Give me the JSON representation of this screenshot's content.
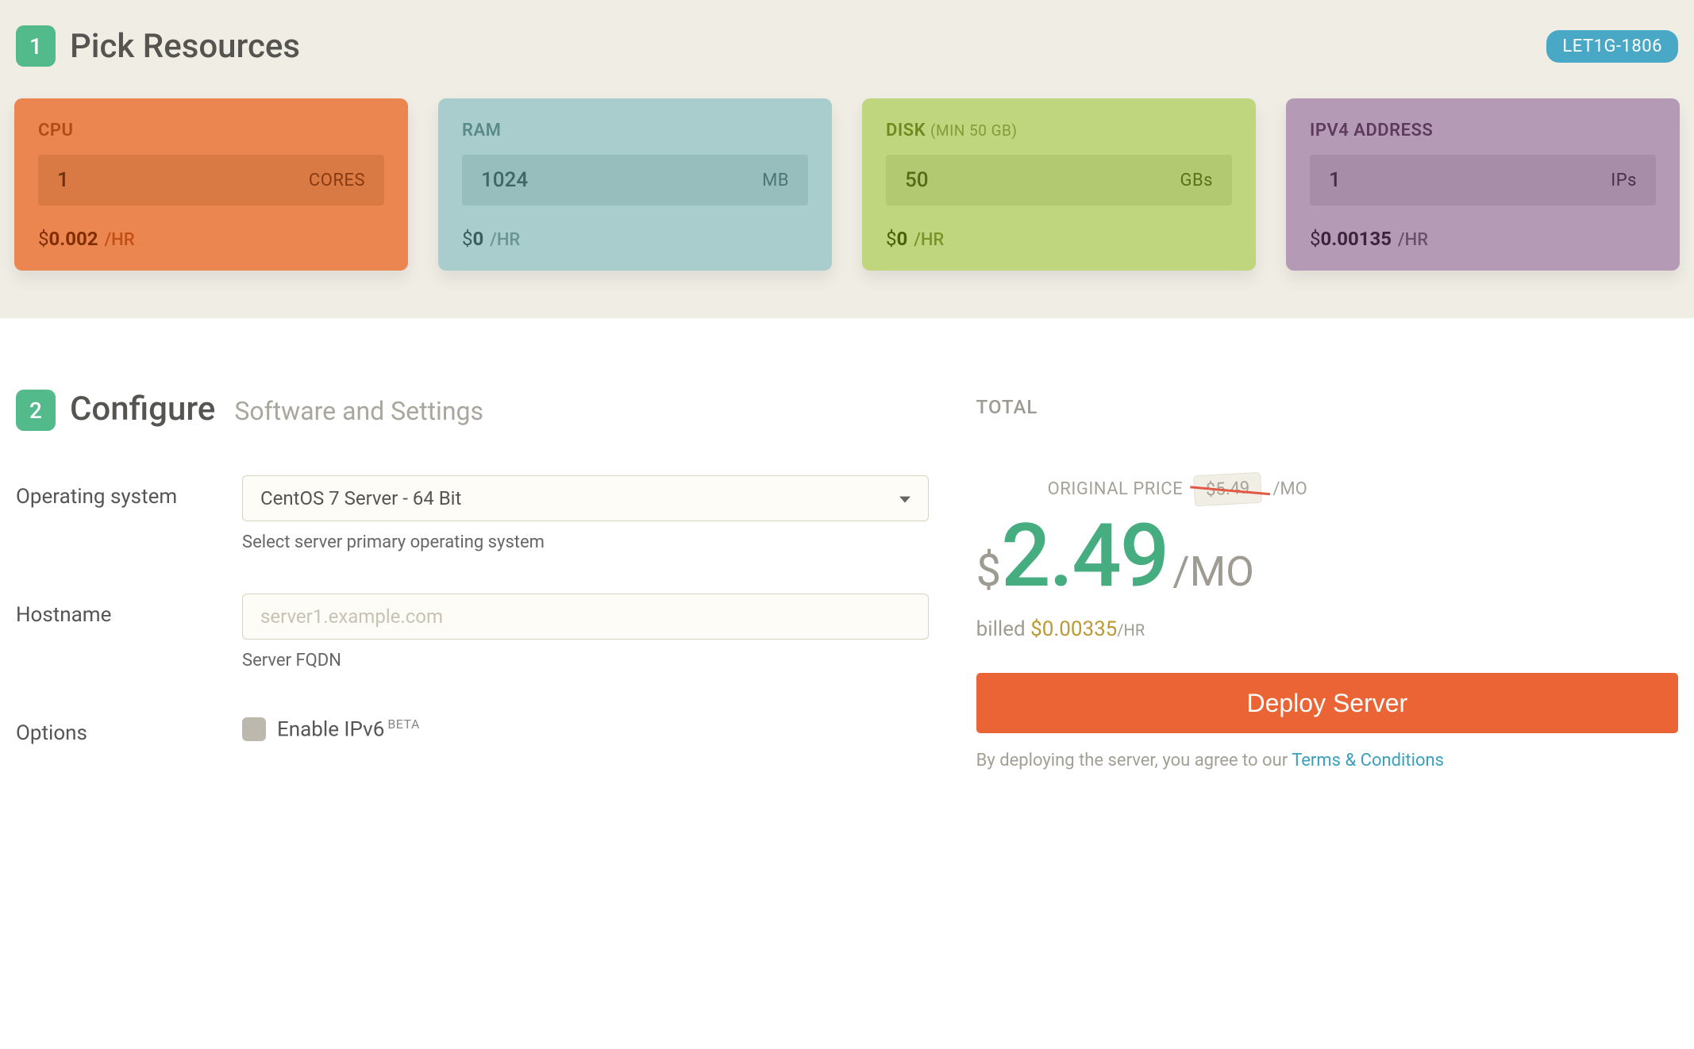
{
  "section1": {
    "step": "1",
    "title": "Pick Resources",
    "promo_code": "LET1G-1806",
    "cards": {
      "cpu": {
        "label": "CPU",
        "label_sub": "",
        "value": "1",
        "unit": "CORES",
        "currency": "$",
        "price": "0.002",
        "per": "/HR"
      },
      "ram": {
        "label": "RAM",
        "label_sub": "",
        "value": "1024",
        "unit": "MB",
        "currency": "$",
        "price": "0",
        "per": "/HR"
      },
      "disk": {
        "label": "DISK",
        "label_sub": "(MIN 50 GB)",
        "value": "50",
        "unit": "GBs",
        "currency": "$",
        "price": "0",
        "per": "/HR"
      },
      "ip": {
        "label": "IPV4 ADDRESS",
        "label_sub": "",
        "value": "1",
        "unit": "IPs",
        "currency": "$",
        "price": "0.00135",
        "per": "/HR"
      }
    }
  },
  "section2": {
    "step": "2",
    "title": "Configure",
    "subtitle": "Software and Settings",
    "os": {
      "label": "Operating system",
      "selected": "CentOS 7 Server - 64 Bit",
      "help": "Select server primary operating system"
    },
    "hostname": {
      "label": "Hostname",
      "placeholder": "server1.example.com",
      "help": "Server FQDN"
    },
    "options": {
      "label": "Options",
      "ipv6_label": "Enable IPv6",
      "ipv6_badge": "BETA"
    }
  },
  "pricing": {
    "total_label": "TOTAL",
    "original_label": "ORIGINAL PRICE",
    "original_price": "$5.49",
    "original_per": "/MO",
    "currency": "$",
    "amount": "2.49",
    "per": "/MO",
    "billed_prefix": "billed",
    "billed_currency": "$",
    "billed_amount": "0.00335",
    "billed_per": "/HR",
    "deploy_label": "Deploy Server",
    "legal_prefix": "By deploying the server, you agree to our ",
    "legal_link": "Terms & Conditions"
  }
}
